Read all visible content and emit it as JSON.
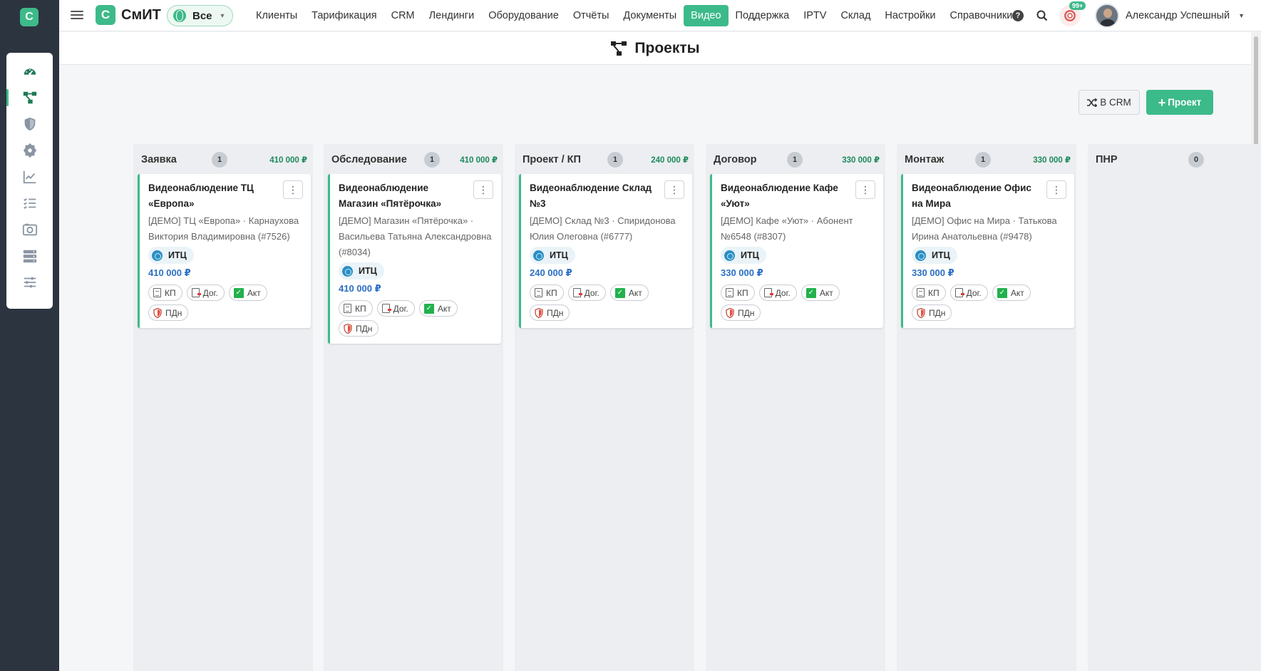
{
  "rail": {
    "logo": "С",
    "items": [
      {
        "icon": "dashboard-icon",
        "active": false
      },
      {
        "icon": "projects-icon",
        "active": true
      },
      {
        "icon": "shield-icon",
        "active": false
      },
      {
        "icon": "badge-gear-icon",
        "active": false
      },
      {
        "icon": "chart-line-icon",
        "active": false
      },
      {
        "icon": "checklist-icon",
        "active": false
      },
      {
        "icon": "camera-icon",
        "active": false
      },
      {
        "icon": "server-icon",
        "active": false
      },
      {
        "icon": "sliders-icon",
        "active": false
      }
    ]
  },
  "topbar": {
    "brand_logo": "С",
    "brand_name": "СмИТ",
    "scope_label": "Все",
    "nav": [
      "Клиенты",
      "Тарификация",
      "CRM",
      "Лендинги",
      "Оборудование",
      "Отчёты",
      "Документы",
      "Видео",
      "Поддержка",
      "IPTV",
      "Склад",
      "Настройки",
      "Справочники"
    ],
    "nav_active": "Видео",
    "help": "?",
    "notifications_badge": "99+",
    "user_name": "Александр Успешный"
  },
  "page": {
    "title": "Проекты",
    "btn_crm": "В CRM",
    "btn_new": "Проект"
  },
  "colors": {
    "accent": "#3dba8a",
    "rail_bg": "#2c3440",
    "price": "#2a6fc4",
    "sum": "#1e8a5a"
  },
  "columns": [
    {
      "title": "Заявка",
      "count": "1",
      "sum": "410 000 ₽",
      "card": {
        "title": "Видеонаблюдение ТЦ «Европа»",
        "subtitle": "[ДЕМО] ТЦ «Европа» · Карнаухова Виктория Владимировна (#7526)",
        "tag": "ИТЦ",
        "price": "410 000 ₽",
        "docs": [
          "КП",
          "Дог.",
          "Акт",
          "ПДн"
        ]
      }
    },
    {
      "title": "Обследование",
      "count": "1",
      "sum": "410 000 ₽",
      "card": {
        "title": "Видеонаблюдение Магазин «Пятёрочка»",
        "subtitle": "[ДЕМО] Магазин «Пятёрочка» · Васильева Татьяна Александровна (#8034)",
        "tag": "ИТЦ",
        "price": "410 000 ₽",
        "docs": [
          "КП",
          "Дог.",
          "Акт",
          "ПДн"
        ]
      }
    },
    {
      "title": "Проект / КП",
      "count": "1",
      "sum": "240 000 ₽",
      "card": {
        "title": "Видеонаблюдение Склад №3",
        "subtitle": "[ДЕМО] Склад №3 · Спиридонова Юлия Олеговна (#6777)",
        "tag": "ИТЦ",
        "price": "240 000 ₽",
        "docs": [
          "КП",
          "Дог.",
          "Акт",
          "ПДн"
        ]
      }
    },
    {
      "title": "Договор",
      "count": "1",
      "sum": "330 000 ₽",
      "card": {
        "title": "Видеонаблюдение Кафе «Уют»",
        "subtitle": "[ДЕМО] Кафе «Уют» · Абонент №6548 (#8307)",
        "tag": "ИТЦ",
        "price": "330 000 ₽",
        "docs": [
          "КП",
          "Дог.",
          "Акт",
          "ПДн"
        ]
      }
    },
    {
      "title": "Монтаж",
      "count": "1",
      "sum": "330 000 ₽",
      "card": {
        "title": "Видеонаблюдение Офис на Мира",
        "subtitle": "[ДЕМО] Офис на Мира · Татькова Ирина Анатольевна (#9478)",
        "tag": "ИТЦ",
        "price": "330 000 ₽",
        "docs": [
          "КП",
          "Дог.",
          "Акт",
          "ПДн"
        ]
      }
    },
    {
      "title": "ПНР",
      "count": "0",
      "sum": "",
      "card": null
    }
  ]
}
